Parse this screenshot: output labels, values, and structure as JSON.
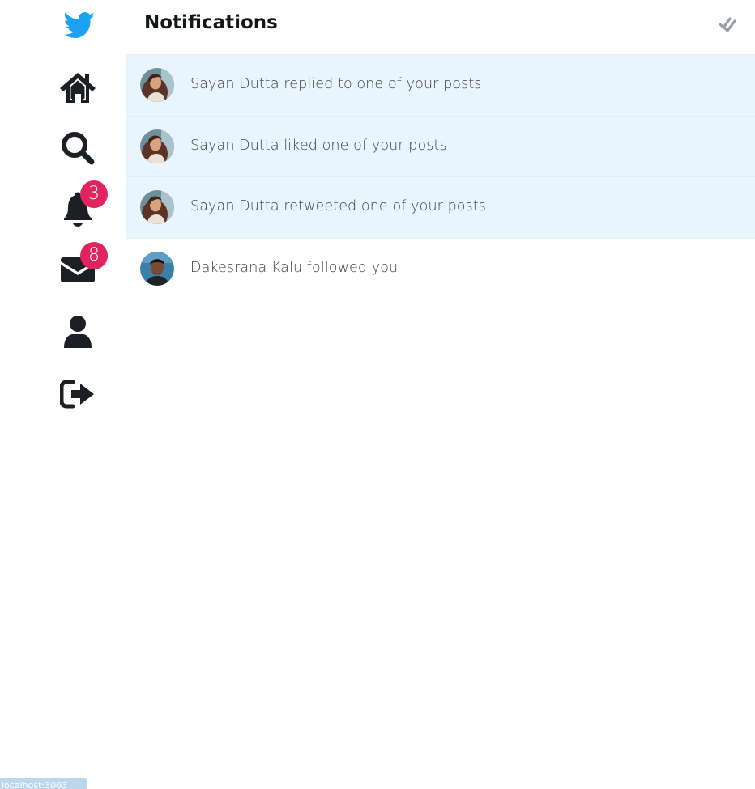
{
  "sidebar": {
    "logo_icon": "twitter-bird-icon",
    "brand_color": "#1da1f2",
    "items": [
      {
        "name": "home",
        "icon": "home-icon"
      },
      {
        "name": "search",
        "icon": "search-icon"
      },
      {
        "name": "notifications",
        "icon": "bell-icon",
        "badge": "3"
      },
      {
        "name": "messages",
        "icon": "envelope-icon",
        "badge": "8"
      },
      {
        "name": "profile",
        "icon": "user-icon"
      },
      {
        "name": "logout",
        "icon": "sign-out-icon"
      }
    ],
    "badge_color": "#e0245e"
  },
  "header": {
    "title": "Notifications",
    "mark_all_icon": "double-check-icon"
  },
  "notifications": [
    {
      "text": "Sayan Dutta replied to one of your posts",
      "unread": true,
      "avatar": "avatar-sayan"
    },
    {
      "text": "Sayan Dutta liked one of your posts",
      "unread": true,
      "avatar": "avatar-sayan"
    },
    {
      "text": "Sayan Dutta retweeted one of your posts",
      "unread": true,
      "avatar": "avatar-sayan"
    },
    {
      "text": "Dakesrana Kalu followed you",
      "unread": false,
      "avatar": "avatar-dakesrana"
    }
  ],
  "status_bar": {
    "url": "localhost:3003"
  },
  "colors": {
    "unread_bg": "#e8f5fe",
    "icon": "#1c1f23"
  }
}
